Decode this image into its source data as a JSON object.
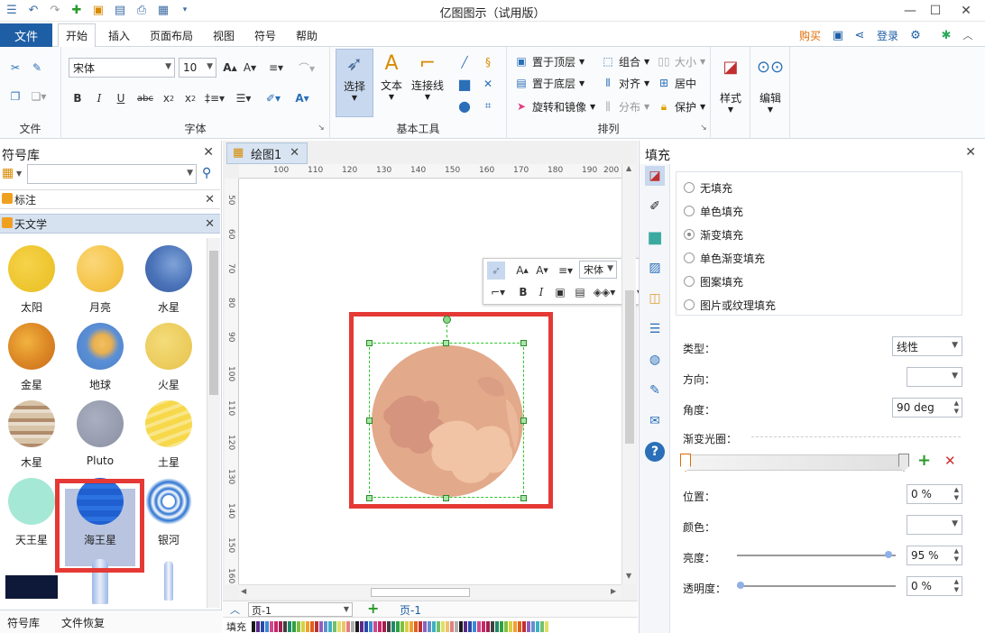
{
  "app": {
    "title": "亿图图示（试用版）"
  },
  "tabs": {
    "file": "文件",
    "items": [
      "开始",
      "插入",
      "页面布局",
      "视图",
      "符号",
      "帮助"
    ],
    "buy": "购买",
    "login": "登录"
  },
  "ribbon": {
    "file_group": "文件",
    "font_group": "字体",
    "font_name": "宋体",
    "font_size": "10",
    "basic_tools_group": "基本工具",
    "select_label": "选择",
    "text_label": "文本",
    "connector_label": "连接线",
    "arrange_group": "排列",
    "bring_front": "置于顶层",
    "send_back": "置于底层",
    "rotate_mirror": "旋转和镜像",
    "group": "组合",
    "align": "对齐",
    "distribute": "分布",
    "size": "大小",
    "center": "居中",
    "protect": "保护",
    "style_label": "样式",
    "edit_label": "编辑"
  },
  "library": {
    "title": "符号库",
    "categories": [
      "标注",
      "天文学"
    ],
    "symbols": [
      "太阳",
      "月亮",
      "水星",
      "金星",
      "地球",
      "火星",
      "木星",
      "Pluto",
      "土星",
      "天王星",
      "海王星",
      "银河"
    ],
    "bottom_tabs": [
      "符号库",
      "文件恢复"
    ]
  },
  "canvas": {
    "doc_tab": "绘图1",
    "ruler_h": [
      "100",
      "110",
      "120",
      "130",
      "140",
      "150",
      "160",
      "170",
      "180",
      "190",
      "200"
    ],
    "ruler_v": [
      "50",
      "60",
      "70",
      "80",
      "90",
      "100",
      "110",
      "120",
      "130",
      "140",
      "150",
      "160"
    ],
    "page_select": "页-1",
    "page_tab": "页-1",
    "fill_label": "填充",
    "float_font": "宋体"
  },
  "fill_panel": {
    "title": "填充",
    "options": [
      "无填充",
      "单色填充",
      "渐变填充",
      "单色渐变填充",
      "图案填充",
      "图片或纹理填充"
    ],
    "selected": "渐变填充",
    "type_label": "类型：",
    "type_value": "线性",
    "direction_label": "方向：",
    "angle_label": "角度：",
    "angle_value": "90 deg",
    "gradient_stops_label": "渐变光圈：",
    "position_label": "位置：",
    "position_value": "0 %",
    "color_label": "颜色：",
    "brightness_label": "亮度：",
    "brightness_value": "95 %",
    "transparency_label": "透明度：",
    "transparency_value": "0 %"
  },
  "colors": {
    "accent": "#1e5ea5",
    "highlight_red": "#e53935",
    "buy_orange": "#e06b00",
    "pluto_base": "#e2a98a"
  }
}
